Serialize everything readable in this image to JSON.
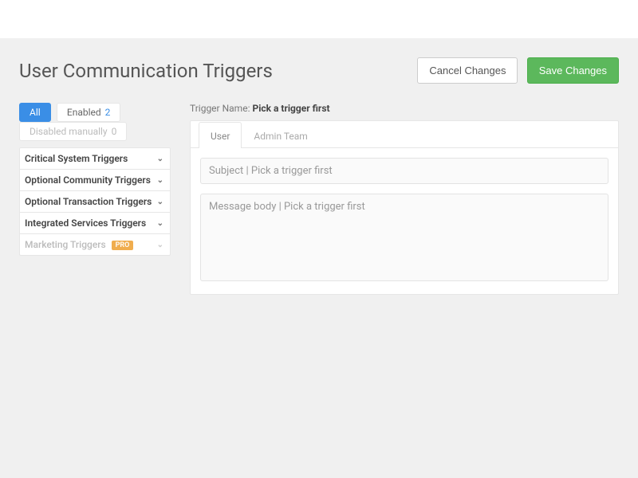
{
  "page": {
    "title": "User Communication Triggers"
  },
  "actions": {
    "cancel": "Cancel Changes",
    "save": "Save Changes"
  },
  "filters": {
    "all": {
      "label": "All"
    },
    "enabled": {
      "label": "Enabled",
      "count": "2"
    },
    "disabled": {
      "label": "Disabled manually",
      "count": "0"
    }
  },
  "sections": [
    {
      "label": "Critical System Triggers",
      "pro": false
    },
    {
      "label": "Optional Community Triggers",
      "pro": false
    },
    {
      "label": "Optional Transaction Triggers",
      "pro": false
    },
    {
      "label": "Integrated Services Triggers",
      "pro": false
    },
    {
      "label": "Marketing Triggers",
      "pro": true
    }
  ],
  "badge": {
    "pro": "PRO"
  },
  "details": {
    "name_label": "Trigger Name: ",
    "name_value": "Pick a trigger first",
    "tabs": {
      "user": "User",
      "admin": "Admin Team"
    },
    "subject_placeholder": "Subject | Pick a trigger first",
    "body_placeholder": "Message body | Pick a trigger first"
  }
}
